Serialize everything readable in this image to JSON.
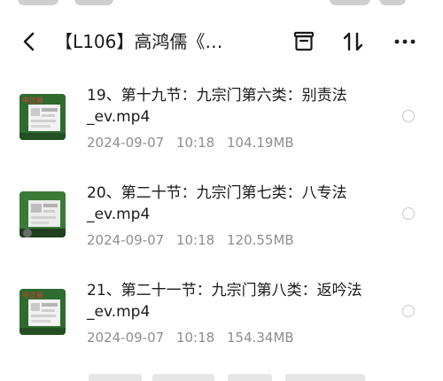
{
  "header": {
    "back_icon": "chevron-left-icon",
    "title": "【L106】高鸿儒《…",
    "actions": [
      "archive-icon",
      "sort-icon",
      "more-icon"
    ]
  },
  "files": [
    {
      "name": "19、第十九节：九宗门第六类：别责法_ev.mp4",
      "date": "2024-09-07",
      "time": "10:18",
      "size": "104.19MB",
      "thumb_label": "中正易"
    },
    {
      "name": "20、第二十节：九宗门第七类：八专法_ev.mp4",
      "date": "2024-09-07",
      "time": "10:18",
      "size": "120.55MB",
      "thumb_label": ""
    },
    {
      "name": "21、第二十一节：九宗门第八类：返吟法_ev.mp4",
      "date": "2024-09-07",
      "time": "10:18",
      "size": "154.34MB",
      "thumb_label": "中正易"
    }
  ],
  "colors": {
    "text": "#1a1a1a",
    "meta": "#8e8e8e",
    "thumb_green": "#2f6a2e",
    "thumb_label": "#e23b2e"
  }
}
